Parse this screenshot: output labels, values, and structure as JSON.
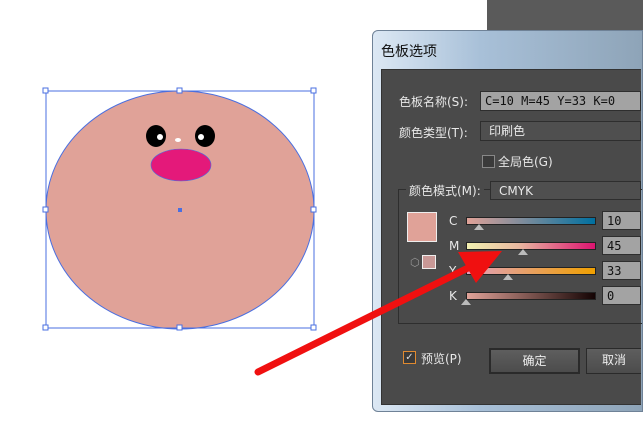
{
  "dialog": {
    "title": "色板选项",
    "swatch_name_label": "色板名称(S):",
    "swatch_name_value": "C=10 M=45 Y=33 K=0",
    "color_type_label": "颜色类型(T):",
    "color_type_value": "印刷色",
    "global_label": "全局色(G)",
    "global_checked": false,
    "color_mode_label": "颜色模式(M):",
    "color_mode_value": "CMYK",
    "channels": [
      {
        "label": "C",
        "value": "10",
        "gradient": "linear-gradient(90deg,#e0a298,#0070a0)"
      },
      {
        "label": "M",
        "value": "45",
        "gradient": "linear-gradient(90deg,#f2f0b0,#e8b8a0 40%,#dc1470)"
      },
      {
        "label": "Y",
        "value": "33",
        "gradient": "linear-gradient(90deg,#e0a0c0,#f0a000)"
      },
      {
        "label": "K",
        "value": "0",
        "gradient": "linear-gradient(90deg,#e0a298,#140404)"
      }
    ],
    "preview_label": "预览(P)",
    "preview_checked": true,
    "ok_label": "确定",
    "cancel_label": "取消",
    "swatch_color": "#e0a298"
  },
  "artwork": {
    "face_color": "#e0a298",
    "mouth_color": "#e4197a",
    "selection_color": "#4a6fe0"
  }
}
